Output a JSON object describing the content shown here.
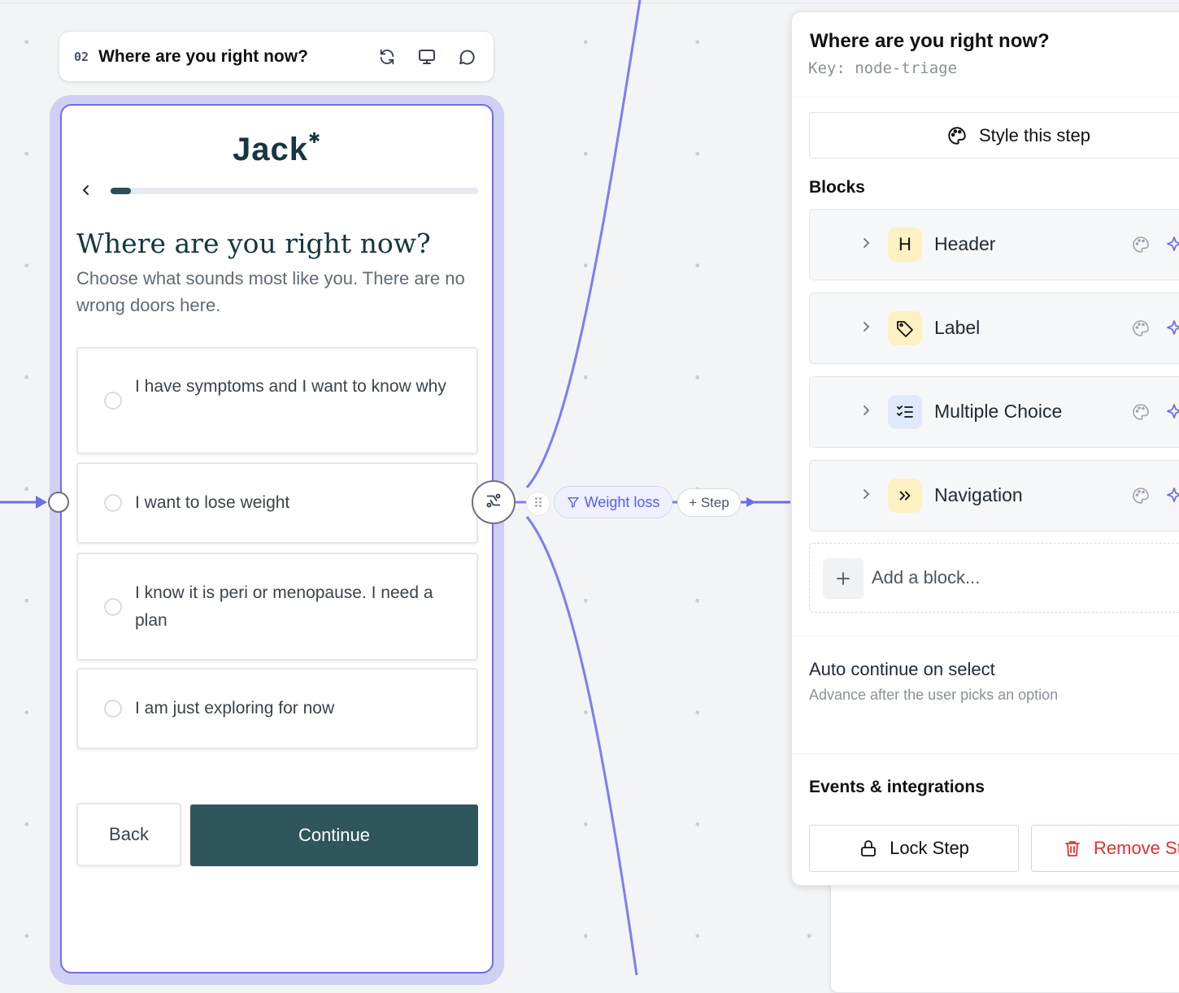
{
  "step_header": {
    "number": "02",
    "title": "Where are you right now?"
  },
  "preview": {
    "brand": "Jack",
    "brand_mark": "✱",
    "progress_fraction": 0.055,
    "question": "Where are you right now?",
    "subtitle": "Choose what sounds most like you. There are no wrong doors here.",
    "options": [
      "I have symptoms and I want to know why",
      "I want to lose weight",
      "I know it is peri or menopause. I need a plan",
      "I am just exploring for now"
    ],
    "back_label": "Back",
    "continue_label": "Continue"
  },
  "edge": {
    "filter_label": "Weight loss",
    "add_step_label": "+ Step"
  },
  "panel": {
    "title": "Where are you right now?",
    "key": "Key: node-triage",
    "style_label": "Style this step",
    "blocks_heading": "Blocks",
    "blocks": [
      {
        "label": "Header",
        "icon": "H"
      },
      {
        "label": "Label",
        "icon": "tag-icon"
      },
      {
        "label": "Multiple Choice",
        "icon": "checklist-icon"
      },
      {
        "label": "Navigation",
        "icon": "double-chevron-icon"
      }
    ],
    "add_block_label": "Add a block...",
    "auto_continue_title": "Auto continue on select",
    "auto_continue_sub": "Advance after the user picks an option",
    "events_heading": "Events & integrations",
    "lock_label": "Lock Step",
    "remove_label": "Remove Step"
  },
  "colors": {
    "accent": "#6d6ee8",
    "brand": "#163640",
    "continue": "#30565d",
    "danger": "#e03131"
  }
}
